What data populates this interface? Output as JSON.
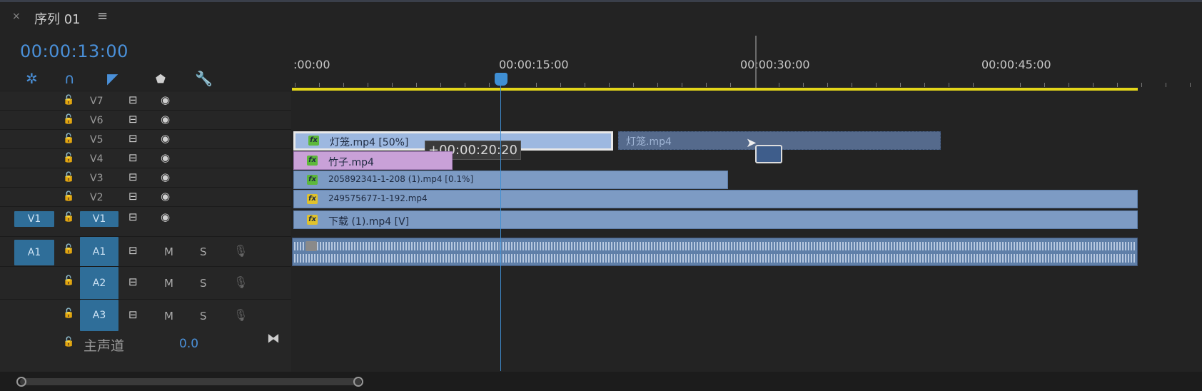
{
  "tab": {
    "close": "×",
    "title": "序列 01",
    "menu": "≡"
  },
  "timecode": "00:00:13:00",
  "ruler": {
    "labels": [
      ":00:00",
      "00:00:15:00",
      "00:00:30:00",
      "00:00:45:00"
    ]
  },
  "video_tracks": [
    {
      "name": "V7"
    },
    {
      "name": "V6"
    },
    {
      "name": "V5"
    },
    {
      "name": "V4"
    },
    {
      "name": "V3"
    },
    {
      "name": "V2"
    },
    {
      "name": "V1",
      "source": "V1"
    }
  ],
  "audio_tracks": [
    {
      "name": "A1",
      "source": "A1",
      "m": "M",
      "s": "S"
    },
    {
      "name": "A2",
      "m": "M",
      "s": "S"
    },
    {
      "name": "A3",
      "m": "M",
      "s": "S"
    }
  ],
  "master": {
    "label": "主声道",
    "value": "0.0"
  },
  "clips": [
    {
      "label": "灯笼.mp4 [50%]",
      "badge": "fx-green"
    },
    {
      "label": "灯笼.mp4",
      "badge": ""
    },
    {
      "label": "竹子.mp4",
      "badge": "fx-green"
    },
    {
      "label": "205892341-1-208 (1).mp4 [0.1%]",
      "badge": "fx-green"
    },
    {
      "label": "249575677-1-192.mp4",
      "badge": "fx-yellow"
    },
    {
      "label": "下载 (1).mp4 [V]",
      "badge": "fx-yellow"
    }
  ],
  "tooltip": "+00:00:20:20",
  "fx_label": "fx",
  "icons": {
    "lock": "lock-icon",
    "film": "toggle-sync-lock-icon",
    "eye": "eye-icon",
    "mic": "mic-icon",
    "wrench": "wrench-icon",
    "snap": "snap-magnet-icon",
    "marker": "marker-icon"
  },
  "colors": {
    "accent": "#4a90d9",
    "work_area": "#e3d61a",
    "clip": "#7d9bc4",
    "pink_clip": "#c9a1d8"
  }
}
